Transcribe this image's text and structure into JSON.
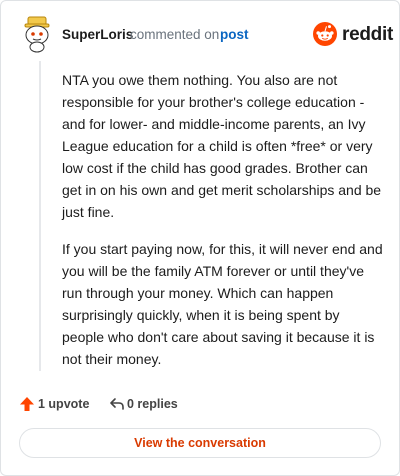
{
  "header": {
    "username": "SuperLoris",
    "action_text": "commented on",
    "post_link": "post",
    "brand": "reddit"
  },
  "comment": {
    "paragraphs": [
      "NTA you owe them nothing. You also are not responsible for your brother's college education - and for lower- and middle-income parents, an Ivy League education for a child is often *free* or very low cost if the child has good grades. Brother can get in on his own and get merit scholarships and be just fine.",
      "If you start paying now, for this, it will never end and you will be the family ATM forever or until they've run through your money. Which can happen surprisingly quickly, when it is being spent by people who don't care about saving it because it is not their money."
    ]
  },
  "actions": {
    "upvotes": "1 upvote",
    "replies": "0 replies"
  },
  "footer": {
    "view_button": "View the conversation"
  },
  "colors": {
    "brand_orange": "#ff4500",
    "link_blue": "#0a66c2",
    "button_text": "#d93a00"
  },
  "icons": {
    "avatar": "snoo-avatar-with-hat",
    "logo": "reddit-snoo-icon",
    "upvote": "upvote-arrow-icon",
    "reply": "reply-arrow-icon"
  }
}
